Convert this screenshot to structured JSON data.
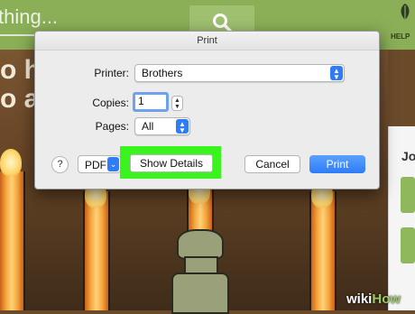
{
  "site": {
    "search_text": "thing...",
    "help_label": "HELP",
    "headline": "o ho\no a",
    "sidebar_label": "Jo",
    "logo_wiki": "wiki",
    "logo_how": "How"
  },
  "dialog": {
    "title": "Print",
    "printer_label": "Printer:",
    "printer_value": "Brothers",
    "copies_label": "Copies:",
    "copies_value": "1",
    "pages_label": "Pages:",
    "pages_value": "All",
    "help_glyph": "?",
    "pdf_label": "PDF",
    "show_details_label": "Show Details",
    "cancel_label": "Cancel",
    "print_label": "Print"
  },
  "colors": {
    "highlight": "#3af41e",
    "accent": "#2f7cf6",
    "site_green": "#8aaf57"
  }
}
